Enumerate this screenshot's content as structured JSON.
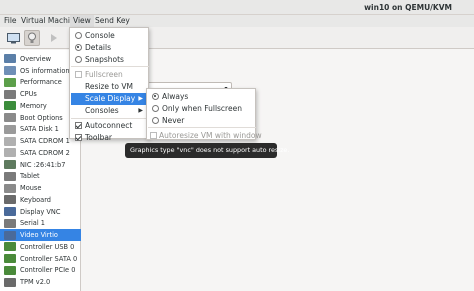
{
  "window": {
    "title": "win10 on QEMU/KVM"
  },
  "menubar": {
    "file": "File",
    "virtual_machine": "Virtual Machine",
    "view": "View",
    "send_key": "Send Key"
  },
  "sidebar": {
    "items": [
      {
        "label": "Overview",
        "icon": "overview-icon",
        "color": "#5b7fa8"
      },
      {
        "label": "OS information",
        "icon": "os-info-icon",
        "color": "#6f8fb6"
      },
      {
        "label": "Performance",
        "icon": "performance-icon",
        "color": "#5c9f4a"
      },
      {
        "label": "CPUs",
        "icon": "cpu-icon",
        "color": "#7a7a7a"
      },
      {
        "label": "Memory",
        "icon": "memory-icon",
        "color": "#3c8d3c"
      },
      {
        "label": "Boot Options",
        "icon": "boot-options-icon",
        "color": "#8a8a8a"
      },
      {
        "label": "SATA Disk 1",
        "icon": "disk-icon",
        "color": "#9a9a9a"
      },
      {
        "label": "SATA CDROM 1",
        "icon": "cdrom-icon",
        "color": "#b0b0b0"
      },
      {
        "label": "SATA CDROM 2",
        "icon": "cdrom-icon",
        "color": "#b0b0b0"
      },
      {
        "label": "NIC :26:41:b7",
        "icon": "nic-icon",
        "color": "#5e7a5e"
      },
      {
        "label": "Tablet",
        "icon": "tablet-icon",
        "color": "#7a7a7a"
      },
      {
        "label": "Mouse",
        "icon": "mouse-icon",
        "color": "#8a8a8a"
      },
      {
        "label": "Keyboard",
        "icon": "keyboard-icon",
        "color": "#6a6a6a"
      },
      {
        "label": "Display VNC",
        "icon": "display-icon",
        "color": "#4a6a9a"
      },
      {
        "label": "Serial 1",
        "icon": "serial-icon",
        "color": "#7a7a7a"
      },
      {
        "label": "Video Virtio",
        "icon": "video-icon",
        "color": "#4a6a9a"
      },
      {
        "label": "Controller USB 0",
        "icon": "controller-icon",
        "color": "#4a8a3a"
      },
      {
        "label": "Controller SATA 0",
        "icon": "controller-icon",
        "color": "#4a8a3a"
      },
      {
        "label": "Controller PCIe 0",
        "icon": "controller-icon",
        "color": "#4a8a3a"
      },
      {
        "label": "TPM v2.0",
        "icon": "tpm-icon",
        "color": "#6a6a6a"
      }
    ],
    "selected_index": 15
  },
  "view_menu": {
    "items": [
      {
        "label": "Console",
        "kind": "radio",
        "checked": false
      },
      {
        "label": "Details",
        "kind": "radio",
        "checked": true
      },
      {
        "label": "Snapshots",
        "kind": "radio",
        "checked": false
      },
      {
        "label": "Fullscreen",
        "kind": "check",
        "checked": false,
        "disabled": true
      },
      {
        "label": "Resize to VM",
        "kind": "plain"
      },
      {
        "label": "Scale Display",
        "kind": "submenu",
        "highlighted": true
      },
      {
        "label": "Consoles",
        "kind": "submenu"
      },
      {
        "label": "Autoconnect",
        "kind": "check",
        "checked": true
      },
      {
        "label": "Toolbar",
        "kind": "check",
        "checked": true
      }
    ]
  },
  "scale_menu": {
    "items": [
      {
        "label": "Always",
        "kind": "radio",
        "checked": true
      },
      {
        "label": "Only when Fullscreen",
        "kind": "radio",
        "checked": false
      },
      {
        "label": "Never",
        "kind": "radio",
        "checked": false
      },
      {
        "label": "Autoresize VM with window",
        "kind": "check",
        "checked": false,
        "disabled": true
      }
    ]
  },
  "tooltip": {
    "text": "Graphics type \"vnc\" does not support auto resize."
  },
  "colors": {
    "accent": "#3584e4",
    "tooltip_bg": "#2b2b2b"
  }
}
